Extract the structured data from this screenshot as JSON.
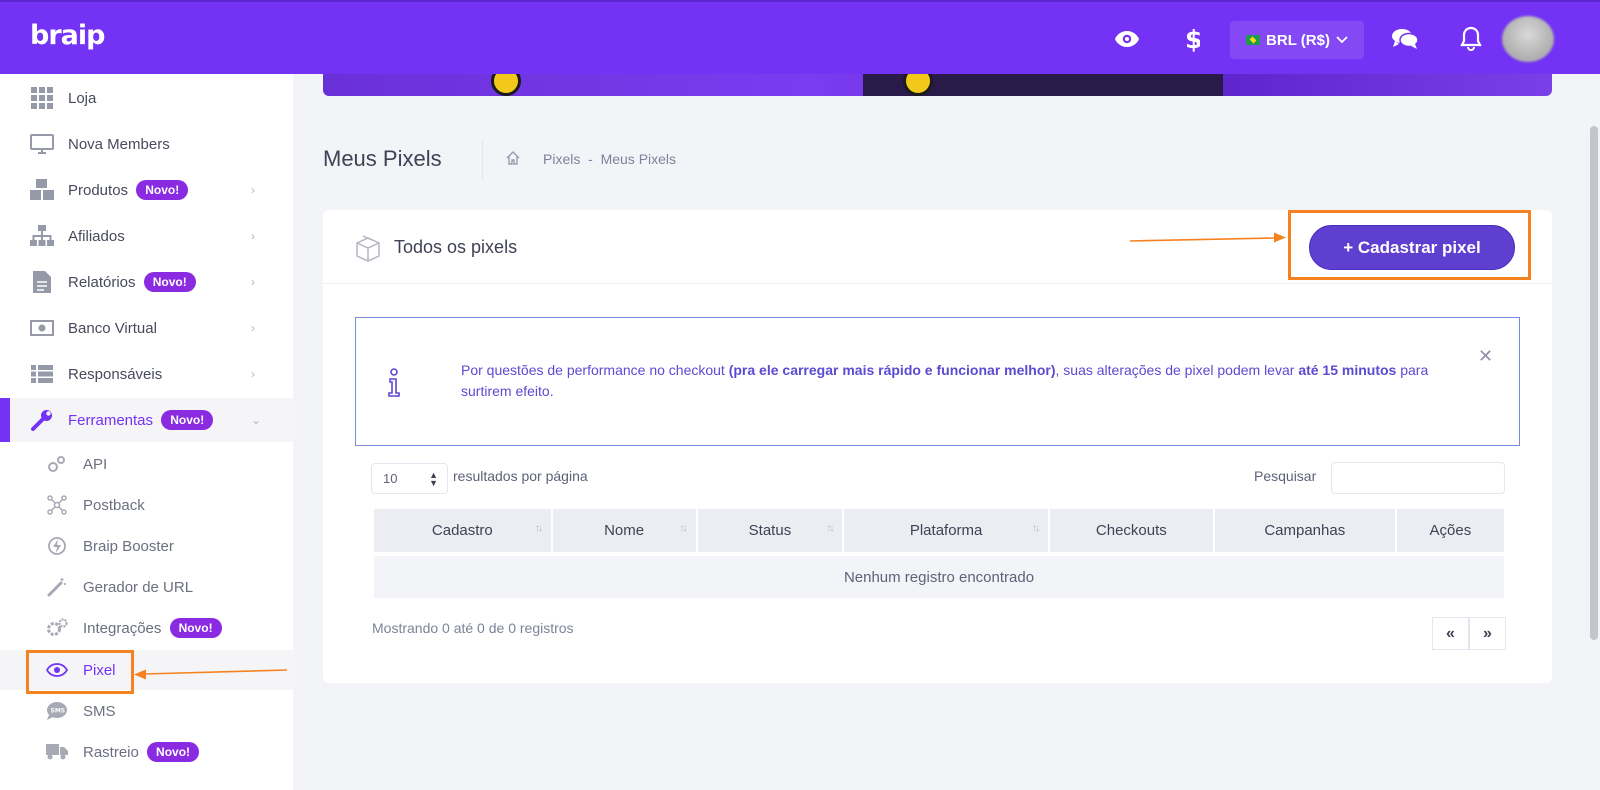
{
  "topbar": {
    "logo": "braip",
    "currency": "BRL (R$)"
  },
  "sidebar": {
    "items": [
      {
        "label": "Loja",
        "icon": "grid-icon"
      },
      {
        "label": "Nova Members",
        "icon": "monitor-icon"
      },
      {
        "label": "Produtos",
        "badge": "Novo!",
        "icon": "boxes-icon"
      },
      {
        "label": "Afiliados",
        "icon": "sitemap-icon"
      },
      {
        "label": "Relatórios",
        "badge": "Novo!",
        "icon": "document-icon"
      },
      {
        "label": "Banco Virtual",
        "icon": "money-icon"
      },
      {
        "label": "Responsáveis",
        "icon": "list-icon"
      },
      {
        "label": "Ferramentas",
        "badge": "Novo!",
        "icon": "wrench-icon"
      }
    ],
    "sub_items": [
      {
        "label": "API",
        "icon": "gears-icon"
      },
      {
        "label": "Postback",
        "icon": "network-icon"
      },
      {
        "label": "Braip Booster",
        "icon": "bolt-icon"
      },
      {
        "label": "Gerador de URL",
        "icon": "magic-wand-icon"
      },
      {
        "label": "Integrações",
        "badge": "Novo!",
        "icon": "cogs-icon"
      },
      {
        "label": "Pixel",
        "icon": "eye-icon"
      },
      {
        "label": "SMS",
        "icon": "sms-bubble-icon"
      },
      {
        "label": "Rastreio",
        "badge": "Novo!",
        "icon": "truck-icon"
      }
    ]
  },
  "page": {
    "title": "Meus Pixels",
    "breadcrumb": "Pixels  -  Meus Pixels"
  },
  "card": {
    "title": "Todos os pixels",
    "add_button": "+ Cadastrar pixel"
  },
  "alert": {
    "part1": "Por questões de performance no checkout ",
    "bold1": "(pra ele carregar mais rápido e funcionar melhor)",
    "part2": ", suas alterações de pixel podem levar ",
    "bold2": "até 15 minutos",
    "part3": " para surtirem efeito."
  },
  "table": {
    "page_length": "10",
    "length_label": "resultados por página",
    "search_label": "Pesquisar",
    "columns": [
      "Cadastro",
      "Nome",
      "Status",
      "Plataforma",
      "Checkouts",
      "Campanhas",
      "Ações"
    ],
    "empty_message": "Nenhum registro encontrado",
    "info": "Mostrando 0 até 0 de 0 registros",
    "prev": "«",
    "next": "»"
  },
  "colors": {
    "brand": "#7332f4",
    "button": "#5e3fcf",
    "highlight": "#f58220"
  }
}
